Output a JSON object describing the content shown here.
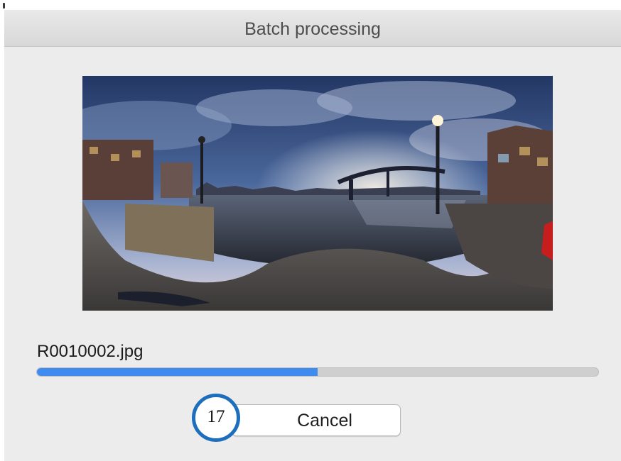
{
  "dialog": {
    "title": "Batch processing",
    "preview_image": "night-waterfront-panorama",
    "current_file": "R0010002.jpg",
    "progress": 0.5,
    "cancel_label": "Cancel"
  },
  "annotation": {
    "step_number": "17",
    "color": "#1d6fbd"
  },
  "colors": {
    "progress_fill": "#3f8cf0",
    "progress_track": "#cfcfcf",
    "dialog_background": "#ececec"
  }
}
